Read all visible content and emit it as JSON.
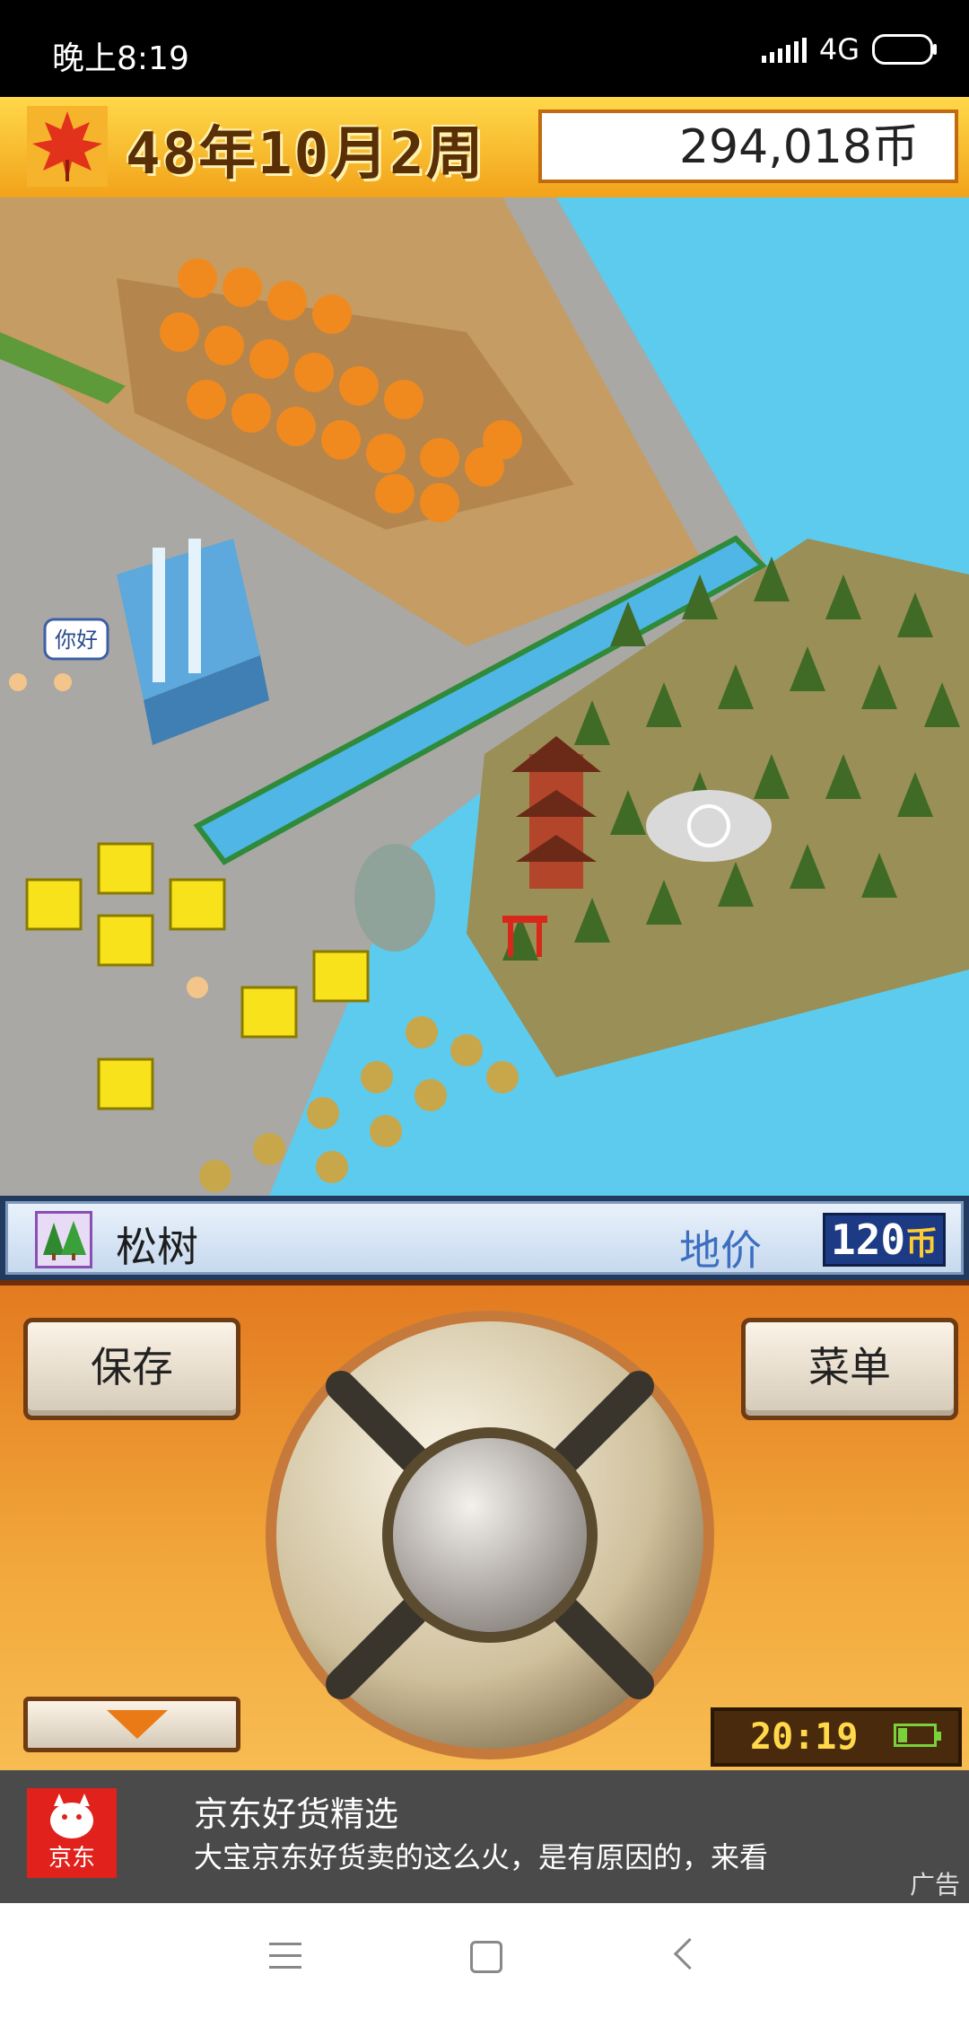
{
  "status_bar": {
    "time": "晚上8:19",
    "network": "4G"
  },
  "game_header": {
    "date": "48年10月2周",
    "money": "294,018币",
    "icon": "maple-leaf-icon"
  },
  "map": {
    "speech_bubble": "你好"
  },
  "selection": {
    "item_icon": "pine-tree-icon",
    "item_name": "松树",
    "price_label": "地价",
    "price_value": "120",
    "price_unit": "币"
  },
  "controls": {
    "save_label": "保存",
    "menu_label": "菜单",
    "game_clock": "20:19"
  },
  "ad": {
    "brand": "京东",
    "title": "京东好货精选",
    "description": "大宝京东好货卖的这么火，是有原因的，来看",
    "tag": "广告"
  },
  "colors": {
    "sea": "#5ccbee",
    "header_gold": "#f2a31a",
    "controller_orange": "#e37a20",
    "price_blue": "#3d6fc0",
    "jd_red": "#e0211c"
  }
}
